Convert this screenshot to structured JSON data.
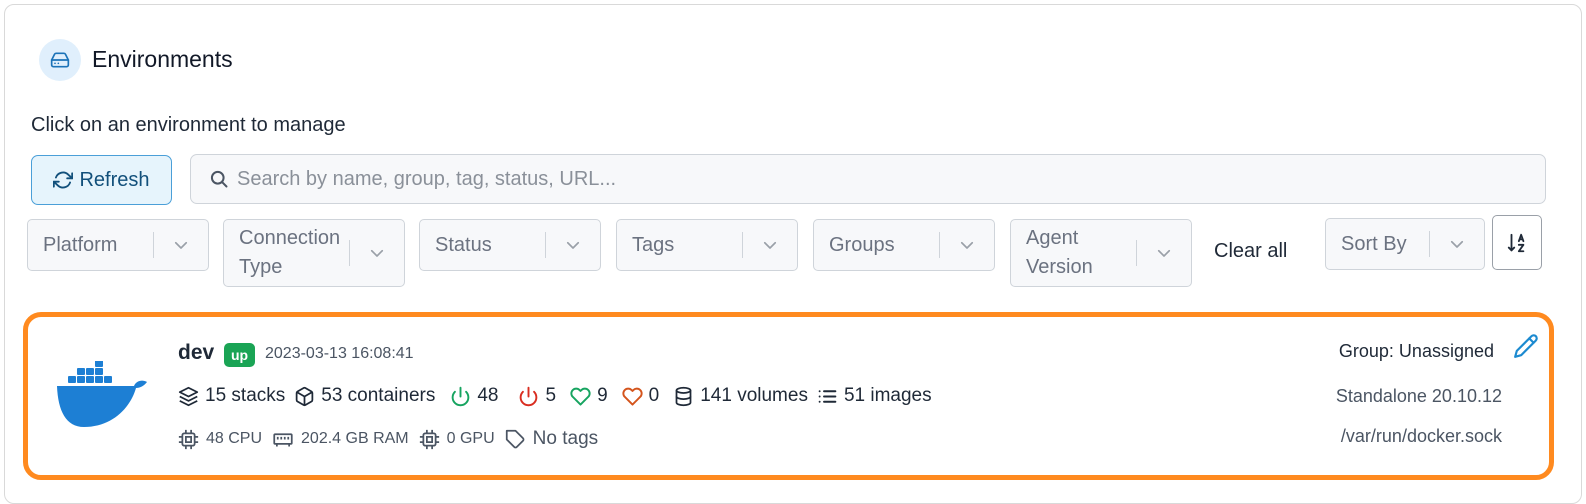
{
  "header": {
    "title": "Environments",
    "subtitle": "Click on an environment to manage",
    "icon": "hard-drive-icon"
  },
  "toolbar": {
    "refresh_label": "Refresh",
    "search_placeholder": "Search by name, group, tag, status, URL...",
    "search_value": ""
  },
  "filters": [
    {
      "label": "Platform"
    },
    {
      "label": "Connection Type"
    },
    {
      "label": "Status"
    },
    {
      "label": "Tags"
    },
    {
      "label": "Groups"
    },
    {
      "label": "Agent Version"
    }
  ],
  "clear_all_label": "Clear all",
  "sort": {
    "label": "Sort By",
    "direction_icon": "sort-alpha-asc-icon"
  },
  "environment": {
    "name": "dev",
    "status": "up",
    "timestamp": "2023-03-13 16:08:41",
    "stacks": "15 stacks",
    "containers": "53 containers",
    "running": "48",
    "stopped": "5",
    "healthy": "9",
    "unhealthy": "0",
    "volumes": "141 volumes",
    "images": "51 images",
    "cpu": "48 CPU",
    "ram": "202.4 GB RAM",
    "gpu": "0 GPU",
    "tags": "No tags",
    "group": "Group: Unassigned",
    "platform": "Standalone 20.10.12",
    "url": "/var/run/docker.sock"
  },
  "colors": {
    "accent": "#1c8ad0",
    "highlight_border": "#ff8a1f",
    "status_up": "#1aa455",
    "running": "#17a460",
    "stopped": "#d92d20",
    "healthy": "#17a460",
    "unhealthy": "#d4541c",
    "docker_blue": "#1d7fd4"
  }
}
